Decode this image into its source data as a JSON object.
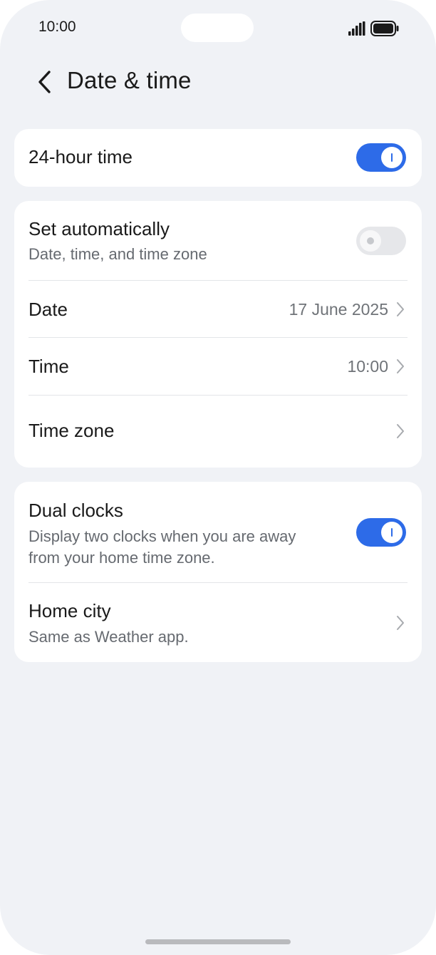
{
  "status_bar": {
    "time": "10:00",
    "signal_icon": "signal-icon",
    "battery_icon": "battery-icon"
  },
  "header": {
    "back_icon": "chevron-left-icon",
    "title": "Date & time"
  },
  "settings": {
    "hour24": {
      "title": "24-hour time",
      "enabled": true
    },
    "auto": {
      "title": "Set automatically",
      "subtitle": "Date, time, and time zone",
      "enabled": false
    },
    "date": {
      "title": "Date",
      "value": "17 June 2025"
    },
    "time": {
      "title": "Time",
      "value": "10:00"
    },
    "timezone": {
      "title": "Time zone",
      "value": ""
    },
    "dual_clocks": {
      "title": "Dual clocks",
      "subtitle_line1": "Display two clocks when you are away",
      "subtitle_line2": "from your home time zone.",
      "enabled": true
    },
    "home_city": {
      "title": "Home city",
      "subtitle": "Same as Weather app."
    }
  },
  "colors": {
    "accent": "#2d6be8",
    "background": "#f0f2f6",
    "card": "#ffffff",
    "toggle_off": "#e6e7ea"
  }
}
